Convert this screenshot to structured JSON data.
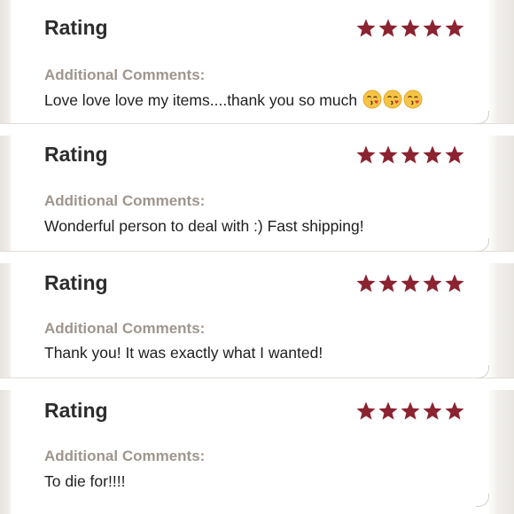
{
  "reviews": [
    {
      "title": "Rating",
      "stars": 5,
      "comments_label": "Additional Comments:",
      "comment": "Love love love my items....thank you so much",
      "emoji": [
        "kissing-face-icon",
        "kissing-face-icon",
        "kissing-face-icon"
      ]
    },
    {
      "title": "Rating",
      "stars": 5,
      "comments_label": "Additional Comments:",
      "comment": "Wonderful person to deal with :) Fast shipping!"
    },
    {
      "title": "Rating",
      "stars": 5,
      "comments_label": "Additional Comments:",
      "comment": "Thank you! It was exactly what I wanted!"
    },
    {
      "title": "Rating",
      "stars": 5,
      "comments_label": "Additional Comments:",
      "comment": "To die for!!!!"
    }
  ],
  "colors": {
    "star": "#8b2330",
    "label": "#9e968e",
    "title": "#2c2c2c",
    "text": "#1f1f1f"
  }
}
